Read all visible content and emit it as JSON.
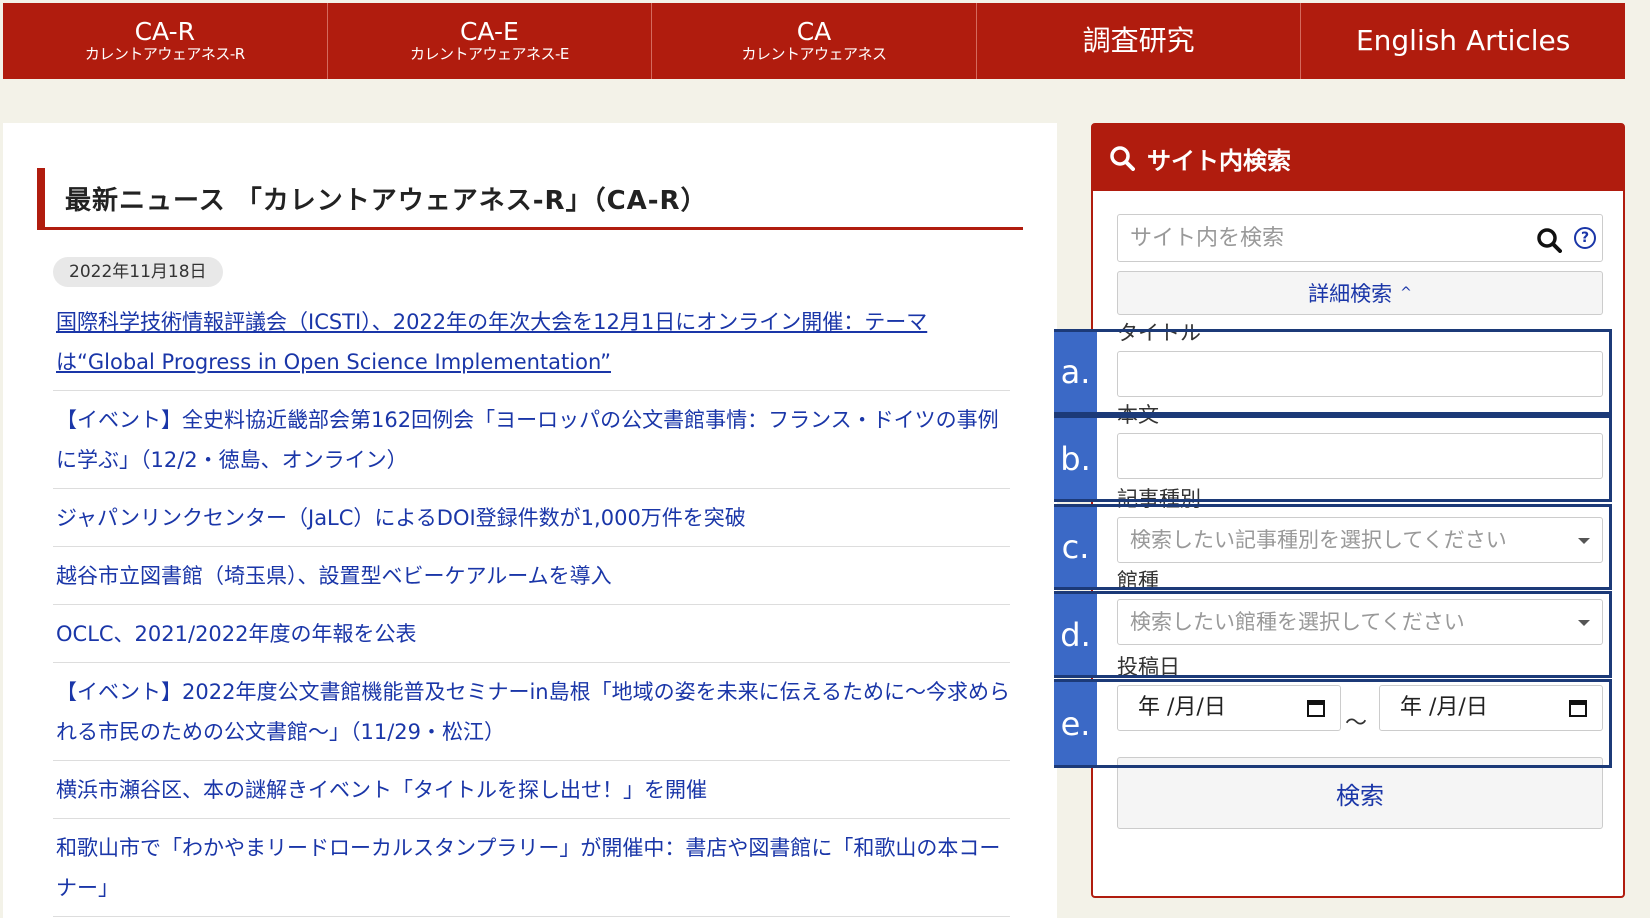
{
  "nav": {
    "items": [
      {
        "main": "CA-R",
        "sub": "カレントアウェアネス-R"
      },
      {
        "main": "CA-E",
        "sub": "カレントアウェアネス-E"
      },
      {
        "main": "CA",
        "sub": "カレントアウェアネス"
      },
      {
        "main": "調査研究",
        "sub": ""
      },
      {
        "main": "English Articles",
        "sub": ""
      }
    ]
  },
  "main": {
    "heading": "最新ニュース 「カレントアウェアネス-R」（CA-R）",
    "date": "2022年11月18日",
    "news": [
      "国際科学技術情報評議会（ICSTI）、2022年の年次大会を12月1日にオンライン開催：テーマは“Global Progress in Open Science Implementation”",
      "【イベント】全史料協近畿部会第162回例会「ヨーロッパの公文書館事情：フランス・ドイツの事例に学ぶ」（12/2・徳島、オンライン）",
      "ジャパンリンクセンター（JaLC）によるDOI登録件数が1,000万件を突破",
      "越谷市立図書館（埼玉県）、設置型ベビーケアルームを導入",
      "OCLC、2021/2022年度の年報を公表",
      "【イベント】2022年度公文書館機能普及セミナーin島根「地域の姿を未来に伝えるために～今求められる市民のための公文書館～」（11/29・松江）",
      "横浜市瀬谷区、本の謎解きイベント「タイトルを探し出せ！」を開催",
      "和歌山市で「わかやまリードローカルスタンプラリー」が開催中：書店や図書館に「和歌山の本コーナー」"
    ]
  },
  "search": {
    "title": "サイト内検索",
    "placeholder": "サイト内を検索",
    "help": "?",
    "advanced": "詳細検索",
    "advanced_chevron": "^",
    "fields": {
      "title_label": "タイトル",
      "body_label": "本文",
      "type_label": "記事種別",
      "type_placeholder": "検索したい記事種別を選択してください",
      "lib_label": "館種",
      "lib_placeholder": "検索したい館種を選択してください",
      "date_label": "投稿日",
      "date_from": "年 /月/日",
      "date_to": "年 /月/日",
      "tilde": "～"
    },
    "submit": "検索"
  },
  "annotations": [
    "a.",
    "b.",
    "c.",
    "d.",
    "e."
  ],
  "colors": {
    "brand_red": "#b01c0e",
    "link_blue": "#1a36a8",
    "annotation_blue": "#3b69c6",
    "annotation_border": "#1c3a78"
  }
}
